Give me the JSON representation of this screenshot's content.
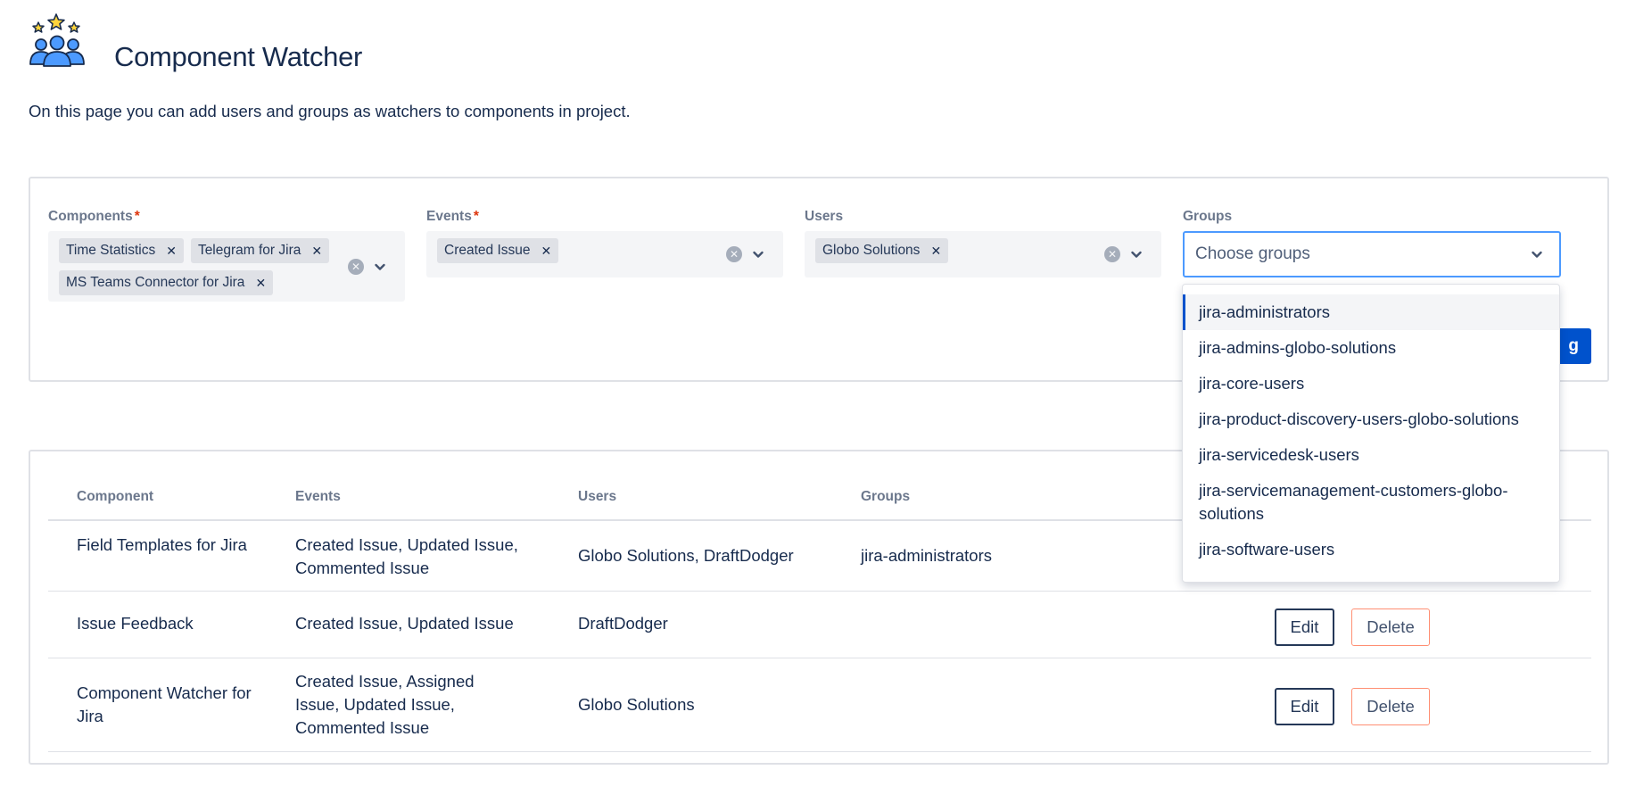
{
  "header": {
    "title": "Component Watcher",
    "description": "On this page you can add users and groups as watchers to components in project."
  },
  "form": {
    "components": {
      "label": "Components",
      "required_mark": "*",
      "chips": [
        "Time Statistics",
        "Telegram for Jira",
        "MS Teams Connector for Jira"
      ]
    },
    "events": {
      "label": "Events",
      "required_mark": "*",
      "chips": [
        "Created Issue"
      ]
    },
    "users": {
      "label": "Users",
      "chips": [
        "Globo Solutions"
      ]
    },
    "groups": {
      "label": "Groups",
      "placeholder": "Choose groups"
    },
    "add_button_label": "g"
  },
  "groups_dropdown": {
    "options": [
      "jira-administrators",
      "jira-admins-globo-solutions",
      "jira-core-users",
      "jira-product-discovery-users-globo-solutions",
      "jira-servicedesk-users",
      "jira-servicemanagement-customers-globo-solutions",
      "jira-software-users"
    ]
  },
  "table": {
    "headers": {
      "component": "Component",
      "events": "Events",
      "users": "Users",
      "groups": "Groups"
    },
    "rows": [
      {
        "component": "Field Templates for Jira",
        "events": "Created Issue, Updated Issue, Commented Issue",
        "users": "Globo Solutions, DraftDodger",
        "groups": "jira-administrators"
      },
      {
        "component": "Issue Feedback",
        "events": "Created Issue, Updated Issue",
        "users": "DraftDodger",
        "groups": ""
      },
      {
        "component": "Component Watcher for Jira",
        "events": "Created Issue, Assigned Issue, Updated Issue, Commented Issue",
        "users": "Globo Solutions",
        "groups": ""
      }
    ],
    "edit_label": "Edit",
    "delete_label": "Delete"
  },
  "colors": {
    "primary": "#0052cc",
    "text": "#172b4d",
    "label": "#6b778c",
    "required": "#de350b",
    "focus": "#4c9aff",
    "danger_border": "#ff8f73"
  }
}
